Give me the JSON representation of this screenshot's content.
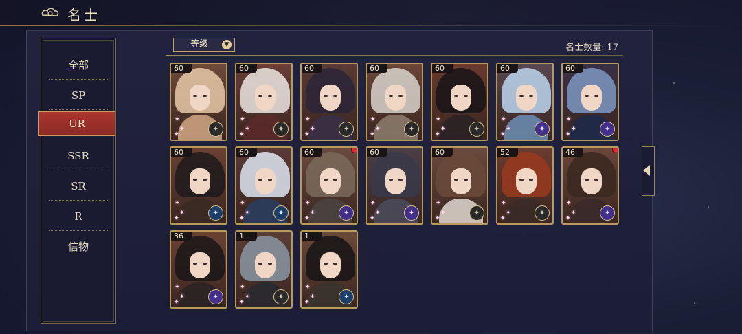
{
  "header": {
    "title": "名士",
    "back_icon": "cloud-back-icon"
  },
  "sidebar": {
    "items": [
      {
        "label": "全部",
        "active": false
      },
      {
        "label": "SP",
        "active": false
      },
      {
        "label": "UR",
        "active": true
      },
      {
        "label": "SSR",
        "active": false
      },
      {
        "label": "SR",
        "active": false
      },
      {
        "label": "R",
        "active": false
      },
      {
        "label": "信物",
        "active": false
      }
    ]
  },
  "toolbar": {
    "sort_label": "等级",
    "count_label": "名士数量:",
    "count_value": "17"
  },
  "colors": {
    "accent_gold": "#b89a5e",
    "active_red": "#a8362e",
    "badge_red": "#e02a3a"
  },
  "cards": [
    {
      "level": "60",
      "emblem": "gray",
      "hair": "#e8c9a8",
      "body": "#caa27e",
      "bg": "#6e4a3a",
      "dot": false
    },
    {
      "level": "60",
      "emblem": "gray",
      "hair": "#ece6e2",
      "body": "#5a2a2a",
      "bg": "#6a3e36",
      "dot": false
    },
    {
      "level": "60",
      "emblem": "gray",
      "hair": "#2a2438",
      "body": "#3a3046",
      "bg": "#5a3a34",
      "dot": false
    },
    {
      "level": "60",
      "emblem": "gray",
      "hair": "#d8d4cc",
      "body": "#8a7a6a",
      "bg": "#6a4638",
      "dot": false
    },
    {
      "level": "60",
      "emblem": "gray",
      "hair": "#181418",
      "body": "#2a2226",
      "bg": "#6a3a2e",
      "dot": false
    },
    {
      "level": "60",
      "emblem": "purple",
      "hair": "#bcd6ee",
      "body": "#6a8aae",
      "bg": "#5a4650",
      "dot": false
    },
    {
      "level": "60",
      "emblem": "purple",
      "hair": "#7e98c2",
      "body": "#1e2a4a",
      "bg": "#3a3046",
      "dot": false
    },
    {
      "level": "60",
      "emblem": "blue",
      "hair": "#1e1a1c",
      "body": "#3a2a24",
      "bg": "#6a4032",
      "dot": false
    },
    {
      "level": "60",
      "emblem": "blue",
      "hair": "#dfe6f2",
      "body": "#2a3e5e",
      "bg": "#5a3a36",
      "dot": false
    },
    {
      "level": "60",
      "emblem": "purple",
      "hair": "#7a6a5a",
      "body": "#4a4440",
      "bg": "#6a4a3e",
      "dot": true
    },
    {
      "level": "60",
      "emblem": "purple",
      "hair": "#3a3a4a",
      "body": "#4a4a5a",
      "bg": "#4a3e46",
      "dot": false
    },
    {
      "level": "60",
      "emblem": "gray",
      "hair": "#6a4a3a",
      "body": "#d8cfc8",
      "bg": "#6a4a3e",
      "dot": false
    },
    {
      "level": "52",
      "emblem": "gray",
      "hair": "#9a3a1e",
      "body": "#3a2a26",
      "bg": "#6a3c2e",
      "dot": false
    },
    {
      "level": "46",
      "emblem": "purple",
      "hair": "#3a2820",
      "body": "#3a2a2a",
      "bg": "#6a463a",
      "dot": true
    },
    {
      "level": "36",
      "emblem": "purple",
      "hair": "#1a1618",
      "body": "#2a2424",
      "bg": "#6a4234",
      "dot": false
    },
    {
      "level": "1",
      "emblem": "gray",
      "hair": "#8a96a2",
      "body": "#2a2a30",
      "bg": "#5a3e36",
      "dot": false
    },
    {
      "level": "1",
      "emblem": "blue",
      "hair": "#161416",
      "body": "#3a342e",
      "bg": "#6a4a3a",
      "dot": false
    }
  ]
}
